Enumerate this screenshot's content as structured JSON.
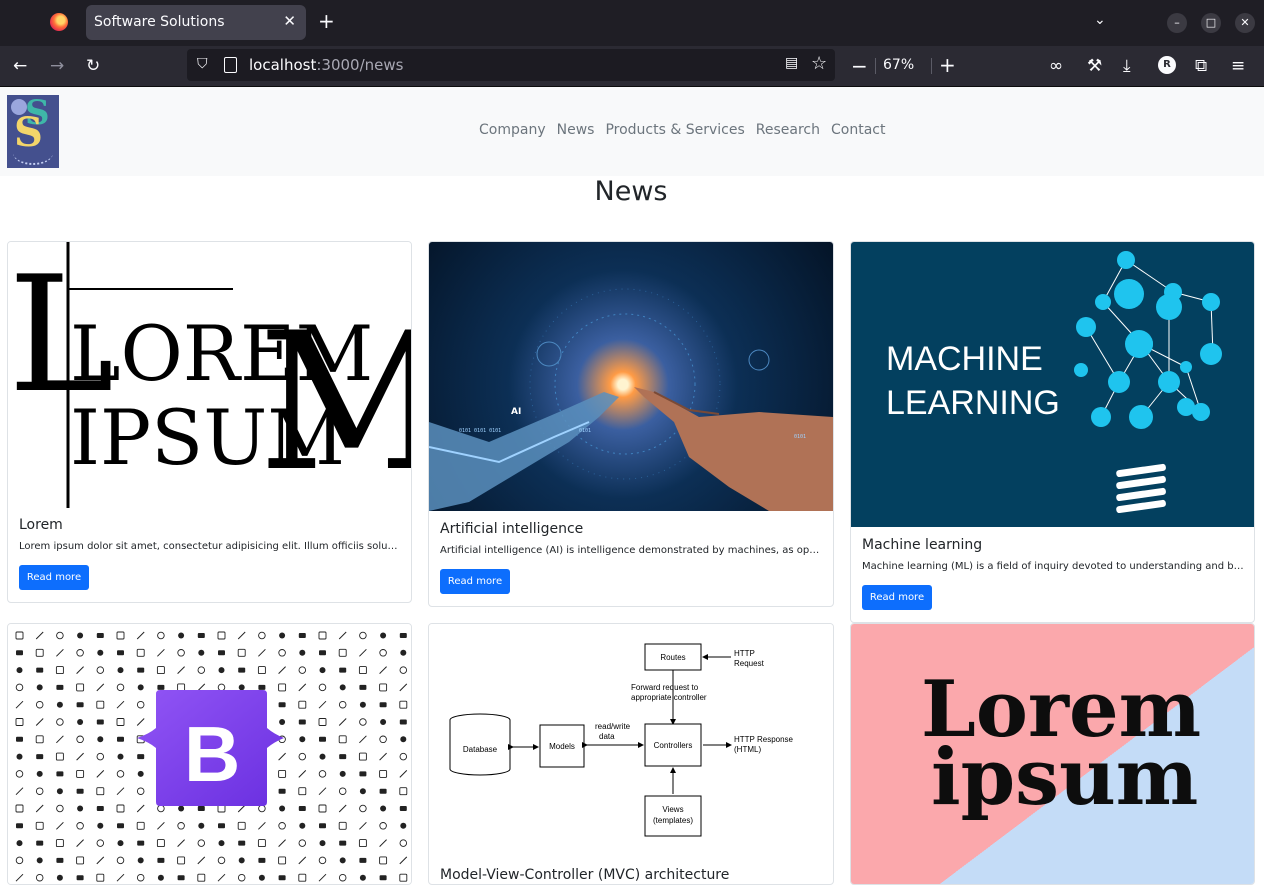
{
  "browser": {
    "tab_title": "Software Solutions",
    "url_host": "localhost",
    "url_path": ":3000/news",
    "zoom": "67%",
    "profile_initial": "R"
  },
  "site": {
    "nav": [
      "Company",
      "News",
      "Products & Services",
      "Research",
      "Contact"
    ],
    "page_title": "News"
  },
  "cards": [
    {
      "title": "Lorem",
      "text": "Lorem ipsum dolor sit amet, consectetur adipisicing elit. Illum officiis soluta mi...",
      "button": "Read more"
    },
    {
      "title": "Artificial intelligence",
      "text": "Artificial intelligence (AI) is intelligence demonstrated by machines, as oppose...",
      "button": "Read more"
    },
    {
      "title": "Machine learning",
      "text": "Machine learning (ML) is a field of inquiry devoted to understanding and buildi...",
      "button": "Read more"
    },
    {
      "title": "Model-View-Controller (MVC) architecture"
    }
  ],
  "images": {
    "lorem_logo": {
      "line1": "LOREM",
      "line2": "IPSUM"
    },
    "ai": {
      "label": "AI",
      "binary": "0101 0101 0101",
      "binary2": "0101"
    },
    "ml": {
      "line1": "MACHINE",
      "line2": "LEARNING"
    },
    "bootstrap": {
      "letter": "B"
    },
    "mvc": {
      "routes": "Routes",
      "http_request": "HTTP\nRequest",
      "forward": "Forward request to appropriate controller",
      "database": "Database",
      "models": "Models",
      "read_write": "read/write data",
      "controllers": "Controllers",
      "http_response": "HTTP Response (HTML)",
      "views": "Views (templates)"
    },
    "lorem_poster": {
      "line1": "Lorem",
      "line2": "ipsum"
    }
  },
  "colors": {
    "primary": "#0d6efd",
    "header_bg": "#f8f9fa",
    "browser_bg": "#1f1e25"
  }
}
